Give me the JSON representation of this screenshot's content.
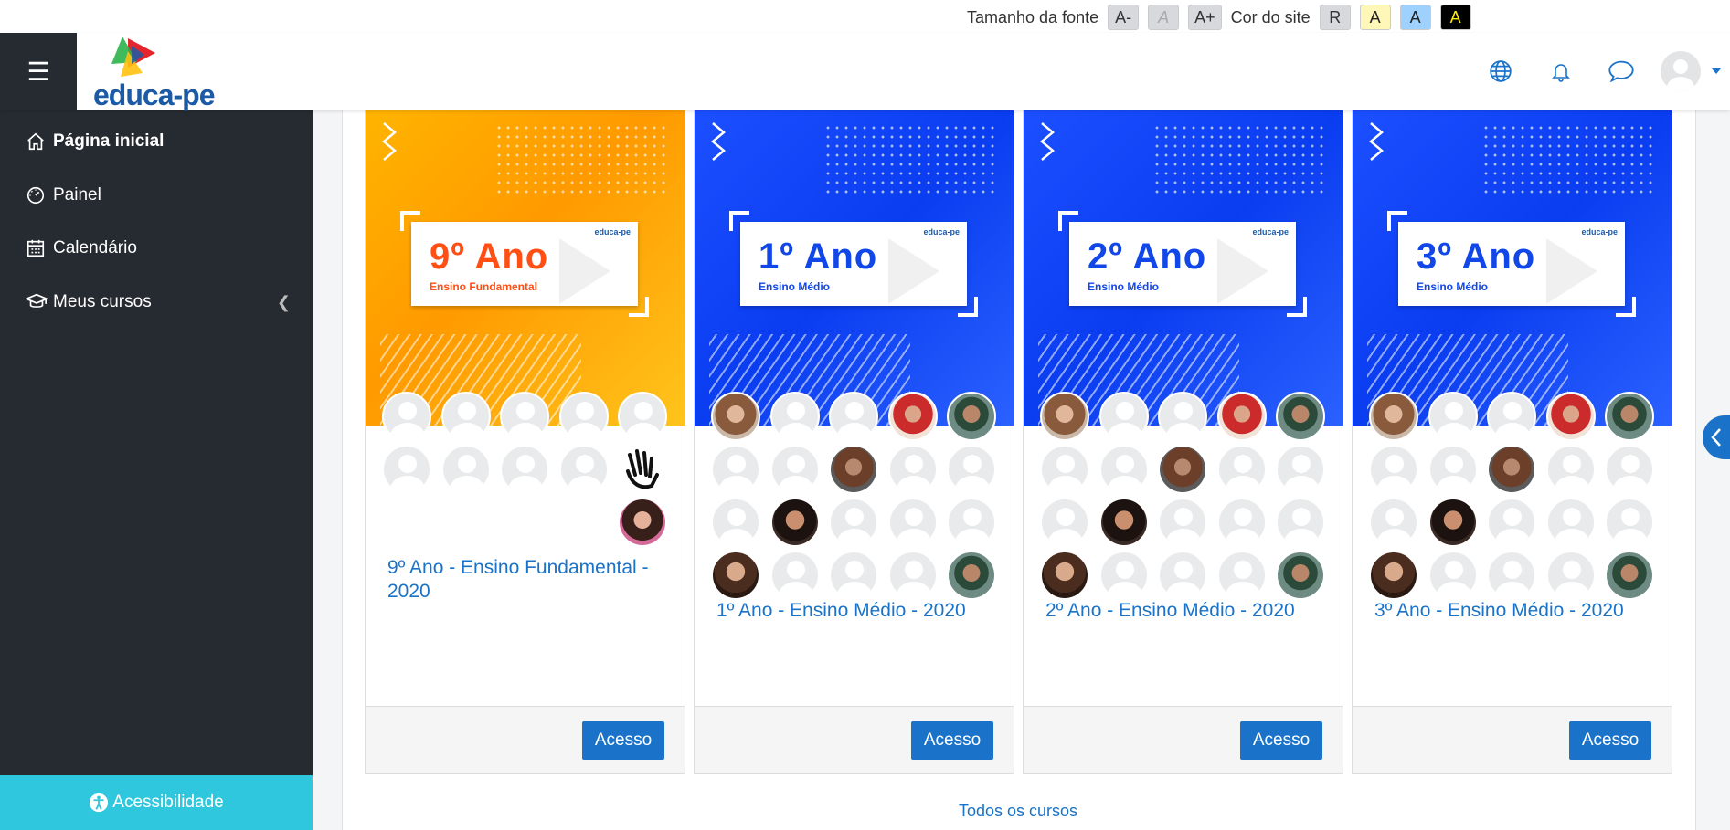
{
  "accessibility_bar": {
    "font_size_label": "Tamanho da fonte",
    "font_decrease": "A-",
    "font_reset": "A",
    "font_increase": "A+",
    "site_color_label": "Cor do site",
    "color_reset": "R",
    "color_yellow": "A",
    "color_blue": "A",
    "color_black": "A"
  },
  "navbar": {
    "logo_text": "educa-pe",
    "icons": [
      "globe-icon",
      "bell-icon",
      "chat-icon",
      "user-avatar"
    ]
  },
  "sidebar": {
    "items": [
      {
        "label": "Página inicial",
        "icon": "home-icon"
      },
      {
        "label": "Painel",
        "icon": "dashboard-icon"
      },
      {
        "label": "Calendário",
        "icon": "calendar-icon"
      },
      {
        "label": "Meus cursos",
        "icon": "graduation-cap-icon"
      }
    ],
    "accessibility_label": "Acessibilidade"
  },
  "courses": [
    {
      "banner_title": "9º Ano",
      "banner_sub": "Ensino Fundamental",
      "banner_logo": "educa-pe",
      "name": "9º Ano - Ensino Fundamental - 2020",
      "button": "Acesso",
      "theme": "orange"
    },
    {
      "banner_title": "1º Ano",
      "banner_sub": "Ensino Médio",
      "banner_logo": "educa-pe",
      "name": "1º Ano - Ensino Médio - 2020",
      "button": "Acesso",
      "theme": "blue"
    },
    {
      "banner_title": "2º Ano",
      "banner_sub": "Ensino Médio",
      "banner_logo": "educa-pe",
      "name": "2º Ano - Ensino Médio - 2020",
      "button": "Acesso",
      "theme": "blue"
    },
    {
      "banner_title": "3º Ano",
      "banner_sub": "Ensino Médio",
      "banner_logo": "educa-pe",
      "name": "3º Ano - Ensino Médio - 2020",
      "button": "Acesso",
      "theme": "blue"
    }
  ],
  "all_courses_link": "Todos os cursos",
  "colors": {
    "sidebar_bg": "#262a31",
    "accent": "#1a73c8",
    "accessibility_btn": "#2ec7dd",
    "banner_orange": "#ffa800",
    "banner_blue": "#1246f7",
    "title_orange": "#ff4f14",
    "title_blue": "#1146e8"
  }
}
